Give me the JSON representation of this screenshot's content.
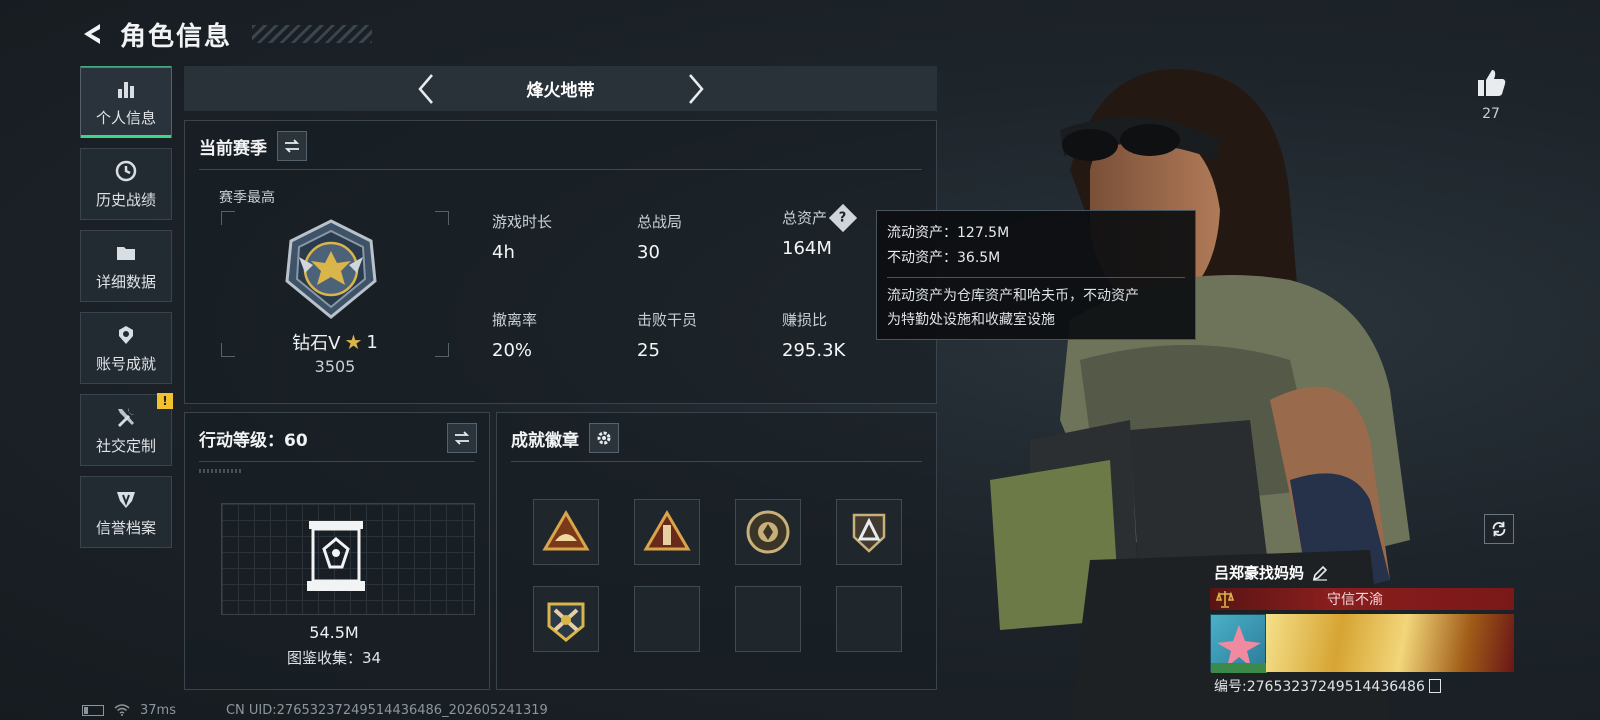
{
  "header": {
    "title": "角色信息"
  },
  "sidebar": {
    "items": [
      {
        "label": "个人信息",
        "icon": "bar-chart-icon",
        "active": true
      },
      {
        "label": "历史战绩",
        "icon": "clock-icon",
        "active": false
      },
      {
        "label": "详细数据",
        "icon": "folder-icon",
        "active": false
      },
      {
        "label": "账号成就",
        "icon": "achievement-icon",
        "active": false
      },
      {
        "label": "社交定制",
        "icon": "tools-icon",
        "active": false,
        "alert": "!"
      },
      {
        "label": "信誉档案",
        "icon": "shield-icon",
        "active": false
      }
    ]
  },
  "mode": {
    "title": "烽火地带"
  },
  "season": {
    "title": "当前赛季",
    "best_label": "赛季最高",
    "rank_name": "钻石V",
    "rank_star": "1",
    "rank_score": "3505",
    "stats": [
      {
        "label": "游戏时长",
        "value": "4h"
      },
      {
        "label": "总战局",
        "value": "30"
      },
      {
        "label": "总资产",
        "value": "164M",
        "help": "?"
      },
      {
        "label": "撤离率",
        "value": "20%"
      },
      {
        "label": "击败干员",
        "value": "25"
      },
      {
        "label": "赚损比",
        "value": "295.3K"
      }
    ]
  },
  "tooltip": {
    "liquid": "流动资产：127.5M",
    "fixed": "不动资产：36.5M",
    "desc_line1": "流动资产为仓库资产和哈夫币，不动资产",
    "desc_line2": "为特勤处设施和收藏室设施"
  },
  "action_level": {
    "title": "行动等级：60",
    "collection_value": "54.5M",
    "collection_count": "图鉴收集：34"
  },
  "badges": {
    "title": "成就徽章",
    "slots": [
      "triangle-camp-badge",
      "triangle-tower-badge",
      "round-emblem-badge",
      "shield-peak-badge",
      "crossed-guns-badge",
      "empty",
      "empty",
      "empty"
    ]
  },
  "profile": {
    "likes": "27",
    "player_name": "吕郑豪找妈妈",
    "honor_title": "守信不渝",
    "uid_label": "编号:27653237249514436486"
  },
  "footer": {
    "ping": "37ms",
    "cn_uid": "CN UID:27653237249514436486_202605241319"
  },
  "colors": {
    "accent": "#39d98a",
    "alert": "#f2c12e",
    "honor": "#8a1e1e",
    "gold": "#d9b54a"
  }
}
